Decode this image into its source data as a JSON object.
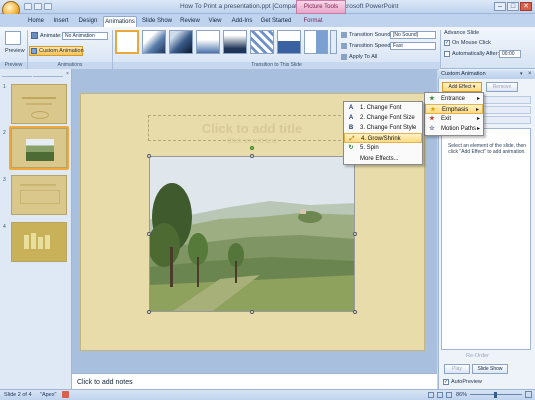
{
  "window": {
    "title": "How To Print a presentation.ppt [Compatibility Mode] - Microsoft PowerPoint",
    "contextual_tab": "Picture Tools",
    "minimize": "–",
    "maximize": "□",
    "close": "✕"
  },
  "tabs": [
    "Home",
    "Insert",
    "Design",
    "Animations",
    "Slide Show",
    "Review",
    "View",
    "Add-Ins",
    "Get Started",
    "Format"
  ],
  "ribbon": {
    "preview_label": "Preview",
    "animate_label": "Animate:",
    "animate_value": "No Animation",
    "custom_animation_label": "Custom Animation",
    "group_preview": "Preview",
    "group_animations": "Animations",
    "group_transition": "Transition to This Slide",
    "transition_sound_label": "Transition Sound:",
    "transition_sound_value": "[No Sound]",
    "transition_speed_label": "Transition Speed:",
    "transition_speed_value": "Fast",
    "apply_to_all_label": "Apply To All",
    "advance_slide_label": "Advance Slide",
    "on_mouse_click_label": "On Mouse Click",
    "automatically_after_label": "Automatically After:",
    "automatically_after_value": "00:00"
  },
  "slides_pane": {
    "numbers": [
      "1",
      "2",
      "3",
      "4"
    ]
  },
  "slide": {
    "title_placeholder": "Click to add title",
    "text_placeholder": "Click to add text"
  },
  "notes": {
    "placeholder": "Click to add notes"
  },
  "task_pane": {
    "title": "Custom Animation",
    "add_effect_label": "Add Effect",
    "remove_label": "Remove",
    "hint_text": "Select an element of the slide, then click \"Add Effect\" to add animation.",
    "re_order_label": "Re-Order",
    "play_label": "Play",
    "slide_show_label": "Slide Show",
    "autopreview_label": "AutoPreview"
  },
  "add_effect_menu": {
    "items": [
      "Entrance",
      "Emphasis",
      "Exit",
      "Motion Paths"
    ]
  },
  "emphasis_submenu": {
    "items": [
      "1. Change Font",
      "2. Change Font Size",
      "3. Change Font Style",
      "4. Grow/Shrink",
      "5. Spin",
      "More Effects..."
    ],
    "selected_index": 3
  },
  "status_bar": {
    "slide_info": "Slide 2 of 4",
    "theme": "\"Apex\"",
    "zoom": "86%"
  },
  "colors": {
    "slide_background": "#e8dcaa",
    "menu_highlight": "#ffd980",
    "ribbon_blue": "#bfd3ee"
  }
}
